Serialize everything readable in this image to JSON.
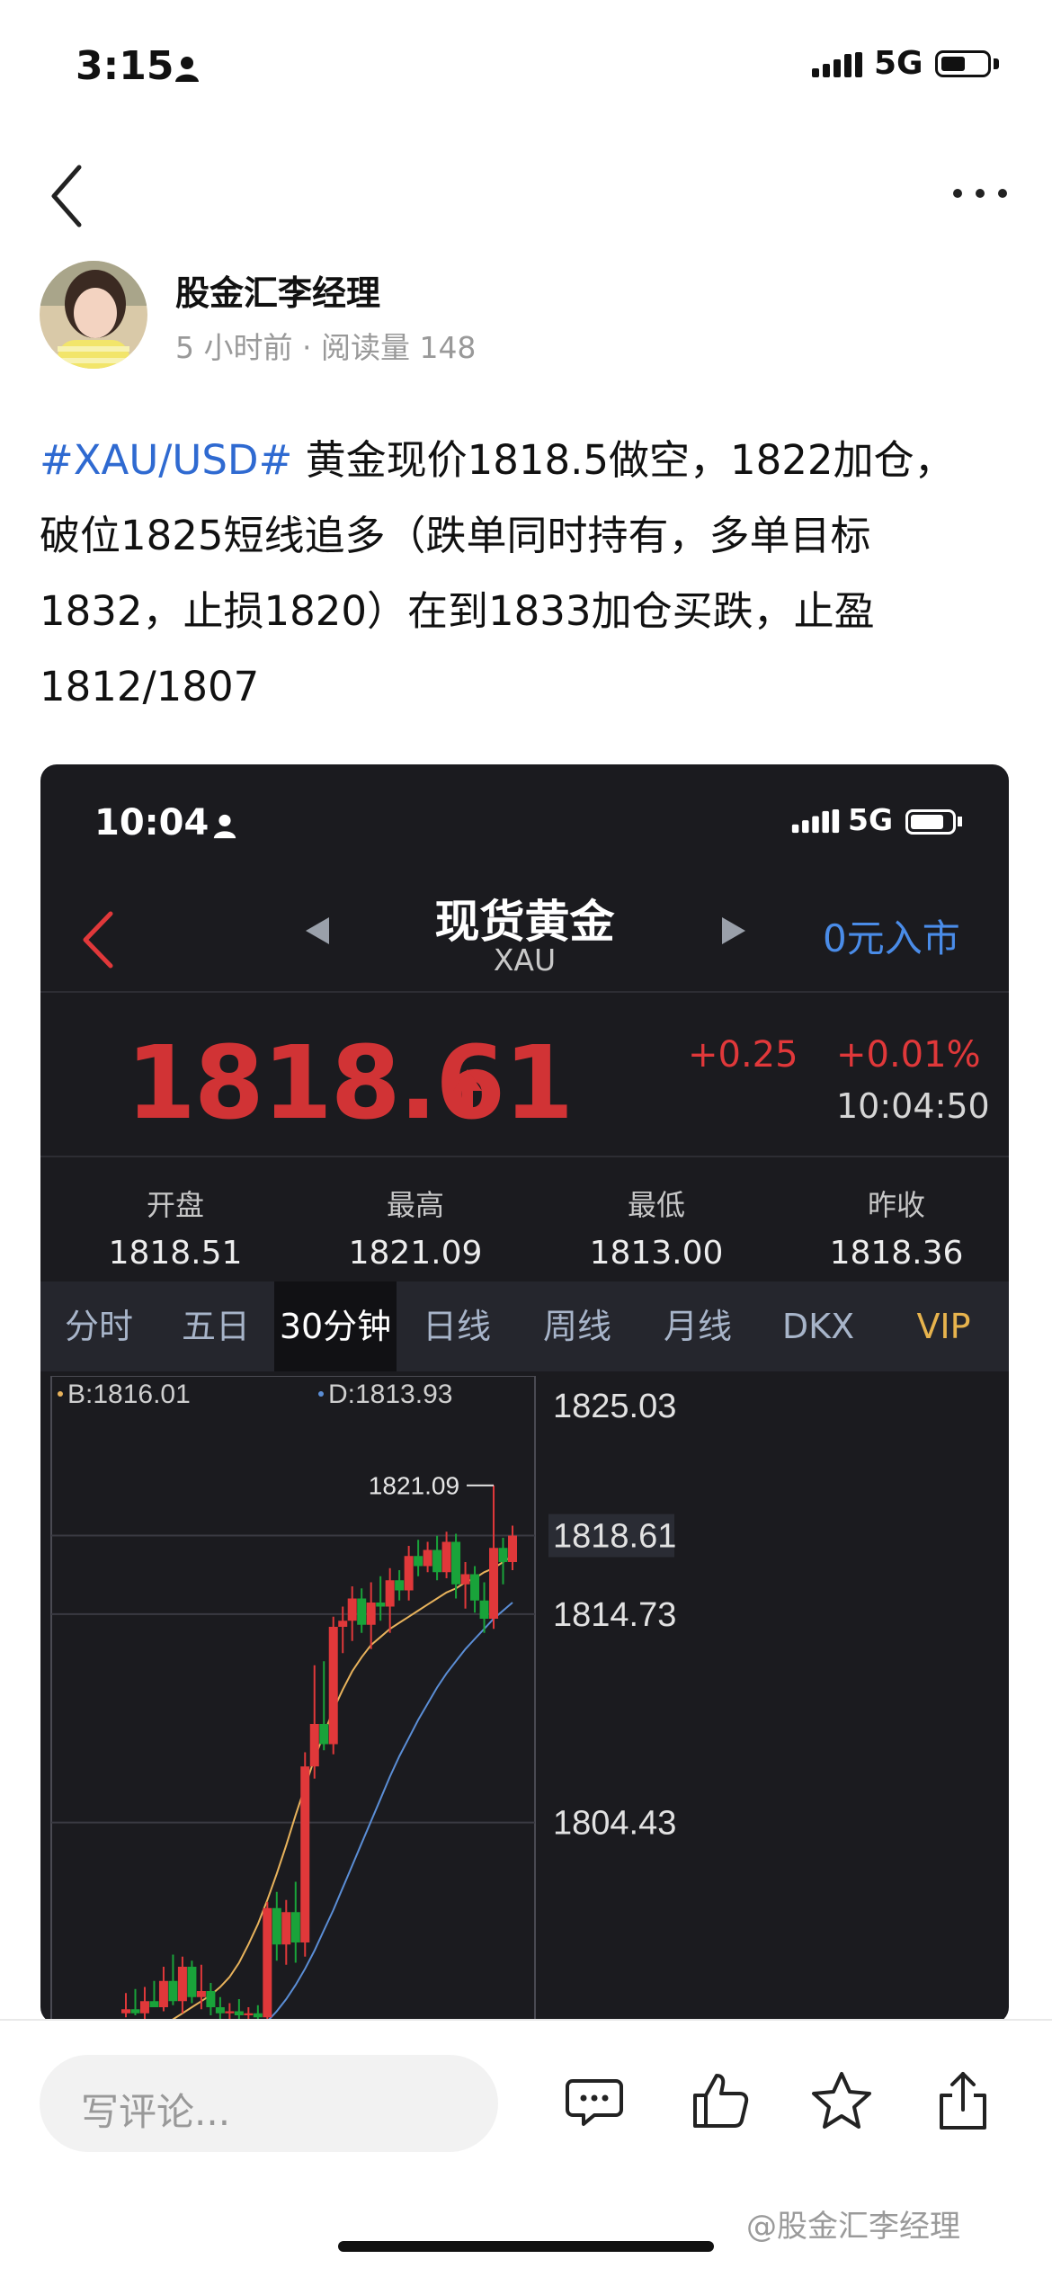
{
  "status_bar": {
    "time": "3:15",
    "network": "5G"
  },
  "post": {
    "author": "股金汇李经理",
    "meta": "5 小时前 · 阅读量 148",
    "hashtag": "#XAU/USD#",
    "text_line1": " 黄金现价1818.5做空，1822加仓，",
    "text_line2": "破位1825短线追多（跌单同时持有，多单目标",
    "text_line3": "1832，止损1820）在到1833加仓买跌，止盈",
    "text_line4": "1812/1807"
  },
  "screenshot": {
    "status": {
      "time": "10:04",
      "network": "5G"
    },
    "header": {
      "title": "现货黄金",
      "subtitle": "XAU",
      "enter_label": "0元入市"
    },
    "quote": {
      "price": "1818.61",
      "change": "+0.25",
      "change_pct": "+0.01%",
      "time": "10:04:50"
    },
    "stats": [
      {
        "label": "开盘",
        "value": "1818.51"
      },
      {
        "label": "最高",
        "value": "1821.09"
      },
      {
        "label": "最低",
        "value": "1813.00"
      },
      {
        "label": "昨收",
        "value": "1818.36"
      }
    ],
    "tabs": [
      "分时",
      "五日",
      "30分钟",
      "日线",
      "周线",
      "月线",
      "DKX",
      "VIP"
    ],
    "active_tab": "30分钟",
    "colors": {
      "up": "#e0383a",
      "down": "#19a33a",
      "line_b": "#e8b35c",
      "line_d": "#5b8ed6",
      "bg": "#1b1b1f"
    }
  },
  "chart_data": {
    "type": "candlestick",
    "legend": [
      "B:1816.01",
      "D:1813.93"
    ],
    "y_tick_labels": [
      "1825.03",
      "1818.61",
      "1814.73",
      "1804.43"
    ],
    "ylim": [
      1794.5,
      1826.5
    ],
    "high_annotation": "1821.09",
    "last_price_label": "1818.61",
    "candles": [
      {
        "o": 1795.0,
        "h": 1796.0,
        "l": 1794.8,
        "c": 1795.2
      },
      {
        "o": 1795.2,
        "h": 1796.2,
        "l": 1794.9,
        "c": 1795.0
      },
      {
        "o": 1795.0,
        "h": 1796.3,
        "l": 1794.7,
        "c": 1795.6
      },
      {
        "o": 1795.6,
        "h": 1796.6,
        "l": 1795.3,
        "c": 1795.3
      },
      {
        "o": 1795.3,
        "h": 1797.3,
        "l": 1795.1,
        "c": 1796.6
      },
      {
        "o": 1796.6,
        "h": 1797.9,
        "l": 1795.4,
        "c": 1795.6
      },
      {
        "o": 1795.6,
        "h": 1797.8,
        "l": 1795.0,
        "c": 1797.3
      },
      {
        "o": 1797.3,
        "h": 1797.6,
        "l": 1795.5,
        "c": 1795.8
      },
      {
        "o": 1795.8,
        "h": 1797.4,
        "l": 1795.2,
        "c": 1796.1
      },
      {
        "o": 1796.1,
        "h": 1796.5,
        "l": 1794.9,
        "c": 1795.3
      },
      {
        "o": 1795.3,
        "h": 1795.8,
        "l": 1794.6,
        "c": 1795.0
      },
      {
        "o": 1795.0,
        "h": 1795.5,
        "l": 1794.5,
        "c": 1795.1
      },
      {
        "o": 1795.1,
        "h": 1795.7,
        "l": 1794.6,
        "c": 1794.9
      },
      {
        "o": 1794.9,
        "h": 1795.3,
        "l": 1794.5,
        "c": 1795.0
      },
      {
        "o": 1795.0,
        "h": 1795.4,
        "l": 1794.4,
        "c": 1794.8
      },
      {
        "o": 1794.8,
        "h": 1800.5,
        "l": 1794.6,
        "c": 1800.2
      },
      {
        "o": 1800.2,
        "h": 1801.0,
        "l": 1797.6,
        "c": 1798.4
      },
      {
        "o": 1798.4,
        "h": 1800.6,
        "l": 1797.4,
        "c": 1800.0
      },
      {
        "o": 1800.0,
        "h": 1801.5,
        "l": 1797.5,
        "c": 1798.5
      },
      {
        "o": 1798.5,
        "h": 1807.9,
        "l": 1797.8,
        "c": 1807.2
      },
      {
        "o": 1807.2,
        "h": 1812.2,
        "l": 1806.6,
        "c": 1809.3
      },
      {
        "o": 1809.3,
        "h": 1812.4,
        "l": 1808.0,
        "c": 1808.3
      },
      {
        "o": 1808.3,
        "h": 1814.6,
        "l": 1807.8,
        "c": 1814.1
      },
      {
        "o": 1814.1,
        "h": 1815.1,
        "l": 1812.8,
        "c": 1814.4
      },
      {
        "o": 1814.4,
        "h": 1816.1,
        "l": 1813.4,
        "c": 1815.5
      },
      {
        "o": 1815.5,
        "h": 1816.0,
        "l": 1813.8,
        "c": 1814.2
      },
      {
        "o": 1814.2,
        "h": 1816.3,
        "l": 1813.0,
        "c": 1815.3
      },
      {
        "o": 1815.3,
        "h": 1816.6,
        "l": 1814.4,
        "c": 1815.1
      },
      {
        "o": 1815.1,
        "h": 1817.0,
        "l": 1813.8,
        "c": 1816.4
      },
      {
        "o": 1816.4,
        "h": 1816.9,
        "l": 1815.4,
        "c": 1815.9
      },
      {
        "o": 1815.9,
        "h": 1818.1,
        "l": 1815.4,
        "c": 1817.6
      },
      {
        "o": 1817.6,
        "h": 1818.4,
        "l": 1816.6,
        "c": 1817.1
      },
      {
        "o": 1817.1,
        "h": 1818.3,
        "l": 1816.8,
        "c": 1817.9
      },
      {
        "o": 1817.9,
        "h": 1818.6,
        "l": 1816.4,
        "c": 1816.8
      },
      {
        "o": 1816.8,
        "h": 1818.8,
        "l": 1816.5,
        "c": 1818.3
      },
      {
        "o": 1818.3,
        "h": 1818.7,
        "l": 1815.5,
        "c": 1816.2
      },
      {
        "o": 1816.2,
        "h": 1817.3,
        "l": 1815.0,
        "c": 1816.7
      },
      {
        "o": 1816.7,
        "h": 1817.1,
        "l": 1814.8,
        "c": 1815.4
      },
      {
        "o": 1815.4,
        "h": 1816.3,
        "l": 1813.8,
        "c": 1814.5
      },
      {
        "o": 1814.5,
        "h": 1821.09,
        "l": 1814.0,
        "c": 1818.0
      },
      {
        "o": 1818.0,
        "h": 1818.5,
        "l": 1816.2,
        "c": 1817.3
      },
      {
        "o": 1817.3,
        "h": 1819.1,
        "l": 1816.9,
        "c": 1818.61
      }
    ],
    "ma_b": [
      1794.0,
      1794.1,
      1794.2,
      1794.3,
      1794.5,
      1794.7,
      1795.0,
      1795.3,
      1795.6,
      1795.9,
      1796.3,
      1796.8,
      1797.5,
      1798.4,
      1799.4,
      1800.6,
      1801.9,
      1803.3,
      1804.8,
      1806.2,
      1807.6,
      1808.8,
      1810.0,
      1811.0,
      1811.9,
      1812.6,
      1813.2,
      1813.6,
      1814.0,
      1814.3,
      1814.6,
      1814.9,
      1815.2,
      1815.5,
      1815.8,
      1816.0,
      1816.3,
      1816.5,
      1816.8,
      1817.0,
      1817.3,
      1817.6
    ],
    "ma_d": [
      1791.0,
      1791.2,
      1791.4,
      1791.6,
      1791.8,
      1792.0,
      1792.2,
      1792.4,
      1792.6,
      1792.8,
      1793.0,
      1793.3,
      1793.6,
      1793.9,
      1794.2,
      1794.6,
      1795.1,
      1795.7,
      1796.4,
      1797.2,
      1798.1,
      1799.1,
      1800.1,
      1801.2,
      1802.3,
      1803.4,
      1804.5,
      1805.6,
      1806.7,
      1807.7,
      1808.6,
      1809.5,
      1810.3,
      1811.1,
      1811.8,
      1812.4,
      1813.0,
      1813.5,
      1814.0,
      1814.5,
      1814.9,
      1815.3
    ]
  },
  "bottom_bar": {
    "comment_placeholder": "写评论...",
    "watermark": "@股金汇李经理"
  }
}
